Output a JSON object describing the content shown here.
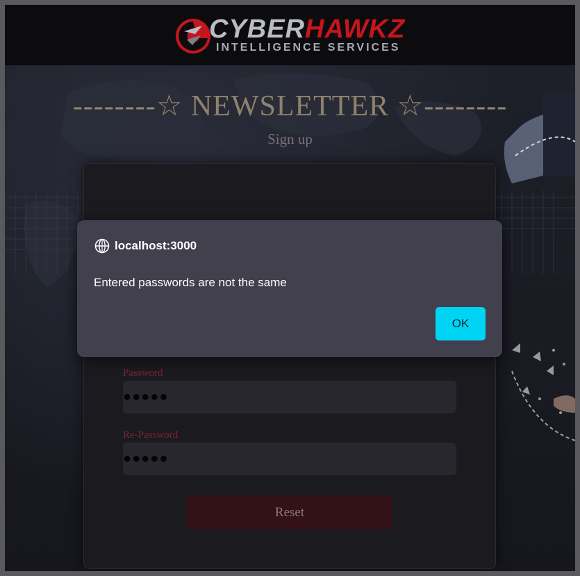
{
  "header": {
    "logo_word_part1": "CYBER",
    "logo_word_part2": "HAWKZ",
    "logo_tagline": "INTELLIGENCE SERVICES"
  },
  "page": {
    "title": "--------☆ NEWSLETTER ☆--------",
    "subtitle": "Sign up"
  },
  "form": {
    "password_label": "Password",
    "password_value": "●●●●●",
    "repassword_label": "Re-Password",
    "repassword_value": "●●●●●",
    "reset_label": "Reset"
  },
  "dialog": {
    "origin": "localhost:3000",
    "message": "Entered passwords are not the same",
    "ok_label": "OK",
    "accent_color": "#00d4f5"
  },
  "colors": {
    "brand_red": "#c4161c",
    "title_color": "#8f826a",
    "label_color": "#7c2336"
  }
}
